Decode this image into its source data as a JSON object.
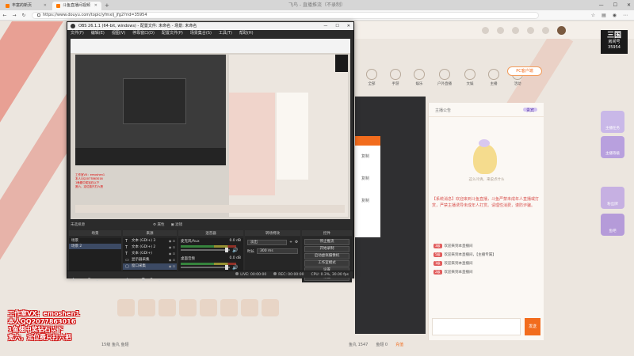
{
  "browser": {
    "tabs": [
      {
        "label": "丰富的新页"
      },
      {
        "label": "斗鱼直播间视频"
      }
    ],
    "new_tab_label": "+",
    "window_title": "飞鸟 - 直播推流（不录制）",
    "url": "https://www.douyu.com/topic/yfmxlj_jfg2?rid=35954"
  },
  "obs": {
    "title": "OBS 26.1.1 (64-bit, windows) - 配置文件: 未命名 - 场景: 未命名",
    "menu": [
      "文件(F)",
      "编辑(E)",
      "视图(V)",
      "停靠窗口(D)",
      "配置文件(P)",
      "场景集合(S)",
      "工具(T)",
      "帮助(H)"
    ],
    "preview_overlay_text": [
      "工作室VX：emoshen1",
      "本人QQ2077863016",
      "1鱼翅中奖钻石以下",
      "宽六，定位费只打六把"
    ],
    "docks": {
      "scenes": {
        "header": "场景",
        "items": [
          "场景",
          "场景 2"
        ]
      },
      "sources": {
        "header": "来源",
        "items": [
          {
            "label": "文本 (GDI+) 3"
          },
          {
            "label": "文本 (GDI+) 2"
          },
          {
            "label": "文本 (GDI+)"
          },
          {
            "label": "显示器采集"
          },
          {
            "label": "窗口采集"
          }
        ]
      },
      "mixer": {
        "header": "混音器",
        "channels": [
          {
            "name": "麦克风/Aux",
            "level": "0.0 dB"
          },
          {
            "name": "桌面音频",
            "level": "0.0 dB"
          }
        ]
      },
      "transitions": {
        "header": "转场特效",
        "type": "淡出",
        "duration_label": "时长",
        "duration": "300 ms"
      },
      "controls": {
        "header": "控件",
        "buttons": [
          "停止推流",
          "开始录制",
          "启动虚拟摄像机",
          "工作室模式",
          "设置",
          "退出"
        ]
      }
    },
    "scene_label": "未选择源",
    "properties_label": "属性",
    "filters_label": "滤镜",
    "status": {
      "live": "LIVE: 00:00:00",
      "rec": "REC: 00:00:00",
      "cpu": "CPU: 0.3%, 30.00 fps"
    }
  },
  "douyu": {
    "categories": [
      "全部",
      "手游",
      "娱乐",
      "户外直播",
      "文娱",
      "主播",
      "活动"
    ],
    "pc_button": "PC客户端",
    "chat_header_left": "主播公告",
    "chat_header_right": "贵宾",
    "mascot_caption": "这么冷清，来说点什么",
    "notice": "【系统消息】欢迎来到斗鱼直播，斗鱼严禁未成年人直播或打赏，严禁主播诱导未成年人打赏。请理性消费，谨防诈骗。",
    "chat_lines": [
      {
        "badge": "3级",
        "text": "欢迎来到本直播间"
      },
      {
        "badge": "5级",
        "text": "欢迎来到本直播间，【主播专属】"
      },
      {
        "badge": "1级",
        "text": "欢迎来到本直播间"
      },
      {
        "badge": "2级",
        "text": "欢迎来到本直播间"
      }
    ],
    "send_label": "发送",
    "room_id_label": "三国",
    "room_sub": "房间号",
    "room_id": "35954",
    "side_icons": [
      "主播任务",
      "主播等级",
      "粉丝牌",
      "鱼吧"
    ],
    "bottom_left": "15级  鱼丸  鱼翅",
    "bottom_right": [
      "鱼丸 1547",
      "鱼翅 0",
      "充值"
    ]
  },
  "watermark": [
    "工作室VX：emoshen1",
    "本人QQ2077863016",
    "1鱼翅中奖钻石以下",
    "宽六，定位费只打六把"
  ]
}
